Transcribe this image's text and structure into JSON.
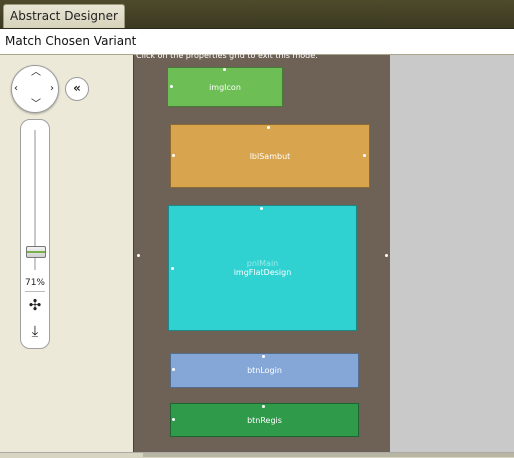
{
  "window": {
    "tab_title": "Abstract Designer",
    "subtitle": "Match Chosen Variant"
  },
  "canvas": {
    "hint": "Click on the properties grid to exit this mode.",
    "views": [
      {
        "name": "imgIcon",
        "color": "#6cbe55"
      },
      {
        "name": "lblSambut",
        "color": "#d8a44e"
      },
      {
        "name": "pnlMain",
        "color": "#2fd2d1"
      },
      {
        "name": "imgFlatDesign",
        "color": "#2fd2d1"
      },
      {
        "name": "btnLogin",
        "color": "#84a7d8"
      },
      {
        "name": "btnRegis",
        "color": "#2f9a4a"
      }
    ]
  },
  "zoom": {
    "level_text": "71%",
    "slider_fraction": 0.71
  },
  "icons": [
    "dpad-arrows-icon",
    "collapse-left-icon",
    "fit-screen-icon",
    "save-image-icon"
  ]
}
